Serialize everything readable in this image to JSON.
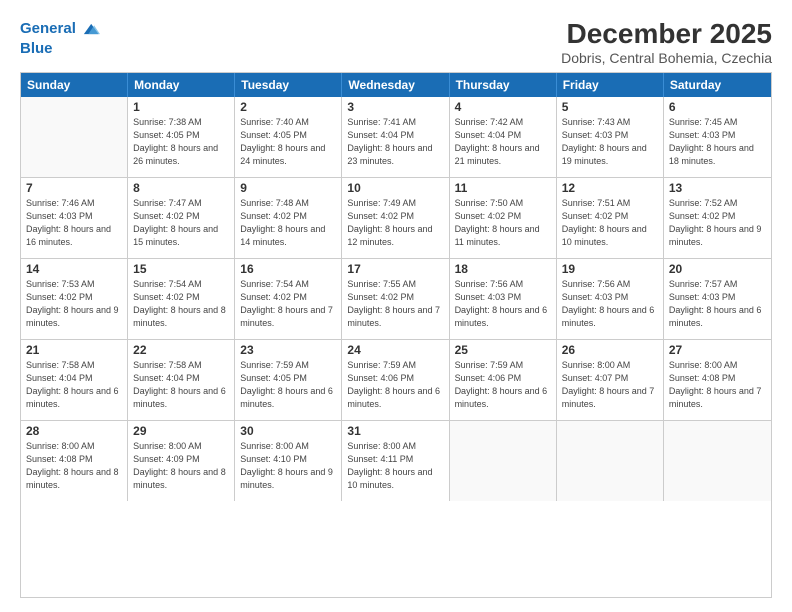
{
  "logo": {
    "line1": "General",
    "line2": "Blue"
  },
  "title": "December 2025",
  "location": "Dobris, Central Bohemia, Czechia",
  "weekdays": [
    "Sunday",
    "Monday",
    "Tuesday",
    "Wednesday",
    "Thursday",
    "Friday",
    "Saturday"
  ],
  "rows": [
    [
      {
        "day": "",
        "sunrise": "",
        "sunset": "",
        "daylight": "",
        "empty": true
      },
      {
        "day": "1",
        "sunrise": "7:38 AM",
        "sunset": "4:05 PM",
        "daylight": "8 hours and 26 minutes."
      },
      {
        "day": "2",
        "sunrise": "7:40 AM",
        "sunset": "4:05 PM",
        "daylight": "8 hours and 24 minutes."
      },
      {
        "day": "3",
        "sunrise": "7:41 AM",
        "sunset": "4:04 PM",
        "daylight": "8 hours and 23 minutes."
      },
      {
        "day": "4",
        "sunrise": "7:42 AM",
        "sunset": "4:04 PM",
        "daylight": "8 hours and 21 minutes."
      },
      {
        "day": "5",
        "sunrise": "7:43 AM",
        "sunset": "4:03 PM",
        "daylight": "8 hours and 19 minutes."
      },
      {
        "day": "6",
        "sunrise": "7:45 AM",
        "sunset": "4:03 PM",
        "daylight": "8 hours and 18 minutes."
      }
    ],
    [
      {
        "day": "7",
        "sunrise": "7:46 AM",
        "sunset": "4:03 PM",
        "daylight": "8 hours and 16 minutes."
      },
      {
        "day": "8",
        "sunrise": "7:47 AM",
        "sunset": "4:02 PM",
        "daylight": "8 hours and 15 minutes."
      },
      {
        "day": "9",
        "sunrise": "7:48 AM",
        "sunset": "4:02 PM",
        "daylight": "8 hours and 14 minutes."
      },
      {
        "day": "10",
        "sunrise": "7:49 AM",
        "sunset": "4:02 PM",
        "daylight": "8 hours and 12 minutes."
      },
      {
        "day": "11",
        "sunrise": "7:50 AM",
        "sunset": "4:02 PM",
        "daylight": "8 hours and 11 minutes."
      },
      {
        "day": "12",
        "sunrise": "7:51 AM",
        "sunset": "4:02 PM",
        "daylight": "8 hours and 10 minutes."
      },
      {
        "day": "13",
        "sunrise": "7:52 AM",
        "sunset": "4:02 PM",
        "daylight": "8 hours and 9 minutes."
      }
    ],
    [
      {
        "day": "14",
        "sunrise": "7:53 AM",
        "sunset": "4:02 PM",
        "daylight": "8 hours and 9 minutes."
      },
      {
        "day": "15",
        "sunrise": "7:54 AM",
        "sunset": "4:02 PM",
        "daylight": "8 hours and 8 minutes."
      },
      {
        "day": "16",
        "sunrise": "7:54 AM",
        "sunset": "4:02 PM",
        "daylight": "8 hours and 7 minutes."
      },
      {
        "day": "17",
        "sunrise": "7:55 AM",
        "sunset": "4:02 PM",
        "daylight": "8 hours and 7 minutes."
      },
      {
        "day": "18",
        "sunrise": "7:56 AM",
        "sunset": "4:03 PM",
        "daylight": "8 hours and 6 minutes."
      },
      {
        "day": "19",
        "sunrise": "7:56 AM",
        "sunset": "4:03 PM",
        "daylight": "8 hours and 6 minutes."
      },
      {
        "day": "20",
        "sunrise": "7:57 AM",
        "sunset": "4:03 PM",
        "daylight": "8 hours and 6 minutes."
      }
    ],
    [
      {
        "day": "21",
        "sunrise": "7:58 AM",
        "sunset": "4:04 PM",
        "daylight": "8 hours and 6 minutes."
      },
      {
        "day": "22",
        "sunrise": "7:58 AM",
        "sunset": "4:04 PM",
        "daylight": "8 hours and 6 minutes."
      },
      {
        "day": "23",
        "sunrise": "7:59 AM",
        "sunset": "4:05 PM",
        "daylight": "8 hours and 6 minutes."
      },
      {
        "day": "24",
        "sunrise": "7:59 AM",
        "sunset": "4:06 PM",
        "daylight": "8 hours and 6 minutes."
      },
      {
        "day": "25",
        "sunrise": "7:59 AM",
        "sunset": "4:06 PM",
        "daylight": "8 hours and 6 minutes."
      },
      {
        "day": "26",
        "sunrise": "8:00 AM",
        "sunset": "4:07 PM",
        "daylight": "8 hours and 7 minutes."
      },
      {
        "day": "27",
        "sunrise": "8:00 AM",
        "sunset": "4:08 PM",
        "daylight": "8 hours and 7 minutes."
      }
    ],
    [
      {
        "day": "28",
        "sunrise": "8:00 AM",
        "sunset": "4:08 PM",
        "daylight": "8 hours and 8 minutes."
      },
      {
        "day": "29",
        "sunrise": "8:00 AM",
        "sunset": "4:09 PM",
        "daylight": "8 hours and 8 minutes."
      },
      {
        "day": "30",
        "sunrise": "8:00 AM",
        "sunset": "4:10 PM",
        "daylight": "8 hours and 9 minutes."
      },
      {
        "day": "31",
        "sunrise": "8:00 AM",
        "sunset": "4:11 PM",
        "daylight": "8 hours and 10 minutes."
      },
      {
        "day": "",
        "sunrise": "",
        "sunset": "",
        "daylight": "",
        "empty": true
      },
      {
        "day": "",
        "sunrise": "",
        "sunset": "",
        "daylight": "",
        "empty": true
      },
      {
        "day": "",
        "sunrise": "",
        "sunset": "",
        "daylight": "",
        "empty": true
      }
    ]
  ]
}
